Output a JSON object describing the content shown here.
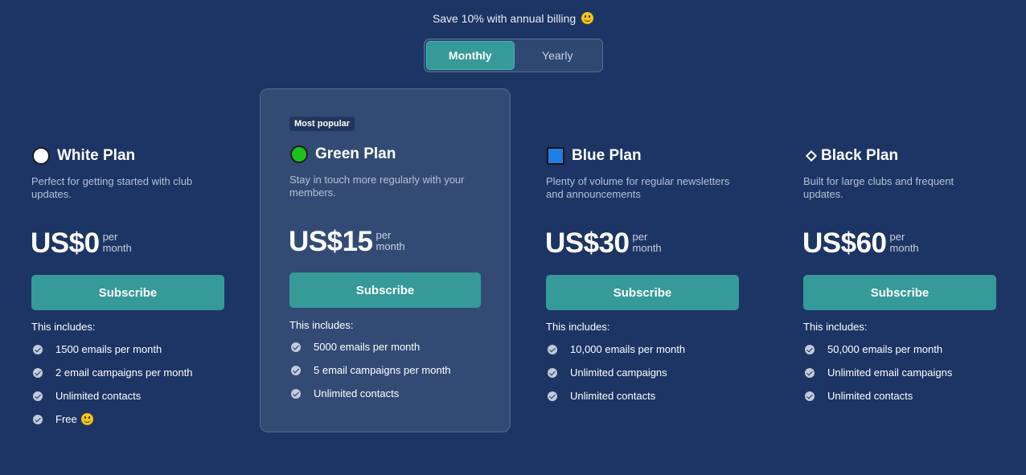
{
  "promo": {
    "text": "Save 10% with annual billing"
  },
  "billing_toggle": {
    "monthly_label": "Monthly",
    "yearly_label": "Yearly",
    "selected": "Monthly"
  },
  "plans": [
    {
      "title": "White Plan",
      "icon": "white-circle-icon",
      "description": "Perfect for getting started with club updates.",
      "price": "US$0",
      "price_unit": "per month",
      "button": "Subscribe",
      "includes_label": "This includes:",
      "features": [
        "1500 emails per month",
        "2 email campaigns per month",
        "Unlimited contacts",
        "Free"
      ]
    },
    {
      "title": "Green Plan",
      "icon": "green-circle-icon",
      "badge": "Most popular",
      "description": "Stay in touch more regularly with your members.",
      "price": "US$15",
      "price_unit": "per month",
      "button": "Subscribe",
      "includes_label": "This includes:",
      "features": [
        "5000 emails per month",
        "5 email campaigns per month",
        "Unlimited contacts"
      ]
    },
    {
      "title": "Blue Plan",
      "icon": "blue-square-icon",
      "description": "Plenty of volume for regular newsletters and announcements",
      "price": "US$30",
      "price_unit": "per month",
      "button": "Subscribe",
      "includes_label": "This includes:",
      "features": [
        "10,000 emails per month",
        "Unlimited campaigns",
        "Unlimited contacts"
      ]
    },
    {
      "title": "Black Plan",
      "icon": "diamond-icon",
      "description": "Built for large clubs and frequent updates.",
      "price": "US$60",
      "price_unit": "per month",
      "button": "Subscribe",
      "includes_label": "This includes:",
      "features": [
        "50,000 emails per month",
        "Unlimited email campaigns",
        "Unlimited contacts"
      ]
    }
  ],
  "colors": {
    "background": "#1d3564",
    "accent": "#359a98",
    "featured_card": "#334b74"
  }
}
